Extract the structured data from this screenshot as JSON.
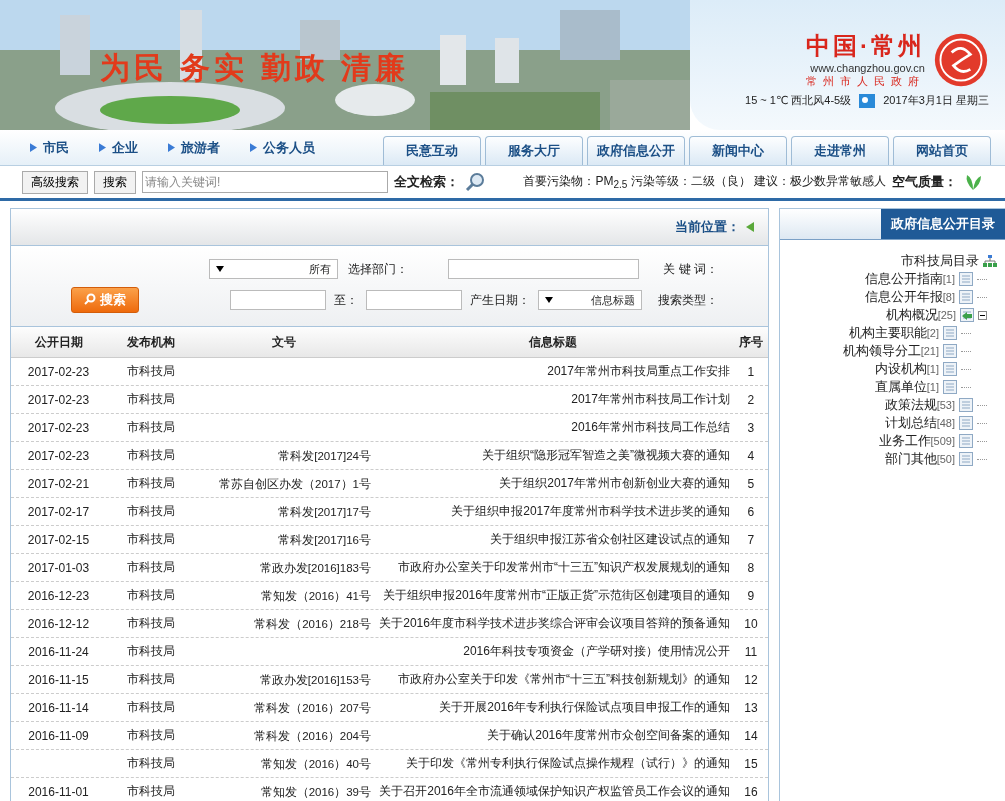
{
  "header": {
    "slogan": "为民 务实 勤政 清廉",
    "logo_title": "中国·常州",
    "logo_url": "www.changzhou.gov.cn",
    "logo_subtitle": "常州市人民政府",
    "date": "2017年3月1日 星期三",
    "weather": "15 ~ 1℃ 西北风4-5级"
  },
  "nav": {
    "tabs": [
      "民意互动",
      "服务大厅",
      "政府信息公开",
      "新闻中心",
      "走进常州",
      "网站首页"
    ],
    "links": [
      "市民",
      "企业",
      "旅游者",
      "公务人员"
    ]
  },
  "toolbar": {
    "air_label": "空气质量：",
    "air_text": "首要污染物：PM$_{2.5}$ 污染等级：二级（良） 建议：极少数异常敏感人",
    "search_label": "全文检索：",
    "placeholder": "请输入关键词!",
    "buttons": [
      "高级搜索",
      "搜索"
    ]
  },
  "sidebar": {
    "title": "政府信息公开目录",
    "tree": {
      "label": "市科技局目录",
      "children": [
        {
          "label": "信息公开指南",
          "count": "[1]"
        },
        {
          "label": "信息公开年报",
          "count": "[8]"
        },
        {
          "label": "机构概况",
          "count": "[25]",
          "expanded": true,
          "children": [
            {
              "label": "机构主要职能",
              "count": "[2]"
            },
            {
              "label": "机构领导分工",
              "count": "[21]"
            },
            {
              "label": "内设机构",
              "count": "[1]"
            },
            {
              "label": "直属单位",
              "count": "[1]"
            }
          ]
        },
        {
          "label": "政策法规",
          "count": "[53]"
        },
        {
          "label": "计划总结",
          "count": "[48]"
        },
        {
          "label": "业务工作",
          "count": "[509]"
        },
        {
          "label": "部门其他",
          "count": "[50]"
        }
      ]
    }
  },
  "main": {
    "breadcrumb": "当前位置：",
    "form": {
      "keyword_label": "关 键 词：",
      "dept_label": "选择部门：",
      "dept_value": "所有",
      "type_label": "搜索类型：",
      "type_value": "信息标题",
      "date_label": "产生日期：",
      "to_label": "至：",
      "search_button": "搜索"
    },
    "table": {
      "columns": [
        "公开日期",
        "发布机构",
        "文号",
        "信息标题",
        "序号"
      ],
      "rows": [
        {
          "no": "1",
          "title": "2017年常州市科技局重点工作安排",
          "org": "市科技局",
          "date": "2017-02-23"
        },
        {
          "no": "2",
          "title": "2017年常州市科技局工作计划",
          "org": "市科技局",
          "date": "2017-02-23"
        },
        {
          "no": "3",
          "title": "2016年常州市科技局工作总结",
          "org": "市科技局",
          "date": "2017-02-23"
        },
        {
          "no": "4",
          "title": "关于组织“隐形冠军智造之美”微视频大赛的通知",
          "doc": "常科发[2017]24号",
          "org": "市科技局",
          "date": "2017-02-23"
        },
        {
          "no": "5",
          "title": "关于组织2017年常州市创新创业大赛的通知",
          "doc": "常苏自创区办发（2017）1号",
          "org": "市科技局",
          "date": "2017-02-21"
        },
        {
          "no": "6",
          "title": "关于组织申报2017年度常州市科学技术进步奖的通知",
          "doc": "常科发[2017]17号",
          "org": "市科技局",
          "date": "2017-02-17"
        },
        {
          "no": "7",
          "title": "关于组织申报江苏省众创社区建设试点的通知",
          "doc": "常科发[2017]16号",
          "org": "市科技局",
          "date": "2017-02-15"
        },
        {
          "no": "8",
          "title": "市政府办公室关于印发常州市“十三五”知识产权发展规划的通知",
          "doc": "常政办发[2016]183号",
          "org": "市科技局",
          "date": "2017-01-03"
        },
        {
          "no": "9",
          "title": "关于组织申报2016年度常州市“正版正货”示范街区创建项目的通知",
          "doc": "常知发（2016）41号",
          "org": "市科技局",
          "date": "2016-12-23"
        },
        {
          "no": "10",
          "title": "关于2016年度市科学技术进步奖综合评审会议项目答辩的预备通知",
          "doc": "常科发（2016）218号",
          "org": "市科技局",
          "date": "2016-12-12"
        },
        {
          "no": "11",
          "title": "2016年科技专项资金（产学研对接）使用情况公开",
          "org": "市科技局",
          "date": "2016-11-24"
        },
        {
          "no": "12",
          "title": "市政府办公室关于印发《常州市“十三五”科技创新规划》的通知",
          "doc": "常政办发[2016]153号",
          "org": "市科技局",
          "date": "2016-11-15"
        },
        {
          "no": "13",
          "title": "关于开展2016年专利执行保险试点项目申报工作的通知",
          "doc": "常科发（2016）207号",
          "org": "市科技局",
          "date": "2016-11-14"
        },
        {
          "no": "14",
          "title": "关于确认2016年度常州市众创空间备案的通知",
          "doc": "常科发（2016）204号",
          "org": "市科技局",
          "date": "2016-11-09"
        },
        {
          "no": "15",
          "title": "关于印发《常州专利执行保险试点操作规程（试行）》的通知",
          "doc": "常知发（2016）40号",
          "org": "市科技局"
        },
        {
          "no": "16",
          "title": "关于召开2016年全市流通领域保护知识产权监管员工作会议的通知",
          "doc": "常知发（2016）39号",
          "org": "市科技局",
          "date": "2016-11-01"
        }
      ]
    }
  }
}
